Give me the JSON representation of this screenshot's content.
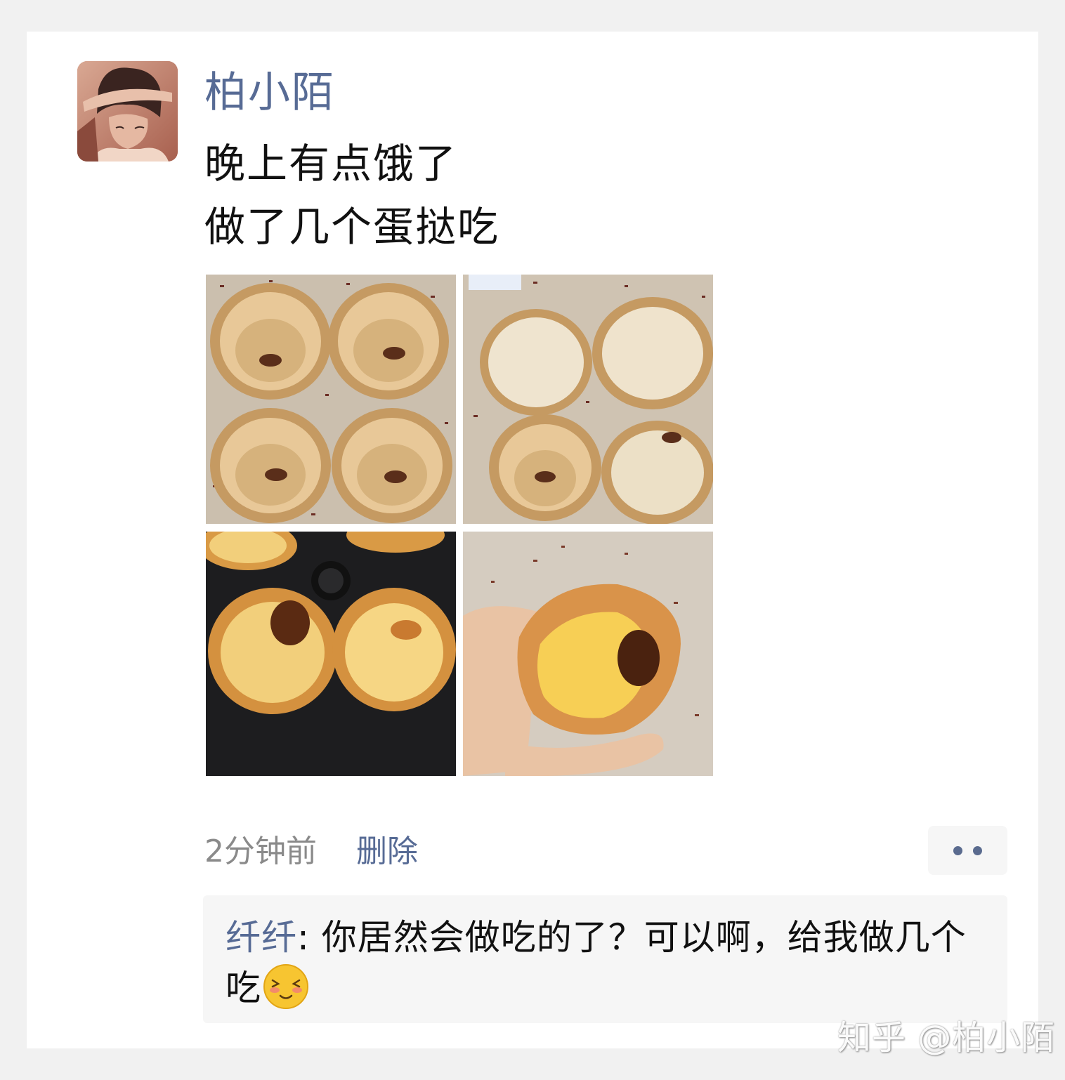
{
  "post": {
    "author": "柏小陌",
    "text_line1": "晚上有点饿了",
    "text_line2": "做了几个蛋挞吃",
    "photos": [
      {
        "name": "empty-tart-shells-with-raisins"
      },
      {
        "name": "tart-shells-with-custard-filling"
      },
      {
        "name": "baked-tarts-in-air-fryer"
      },
      {
        "name": "baked-tart-held-in-hand"
      }
    ],
    "time": "2分钟前",
    "delete_label": "删除"
  },
  "comments": [
    {
      "user": "纤纤",
      "separator": ": ",
      "text": "你居然会做吃的了？可以啊，给我做几个吃",
      "emoji": "blushing-smile-emoji"
    }
  ],
  "watermark": "知乎 @柏小陌",
  "colors": {
    "link": "#576b95",
    "text": "#111111",
    "meta": "#8a8a8a",
    "comment_bg": "#f6f6f6"
  }
}
